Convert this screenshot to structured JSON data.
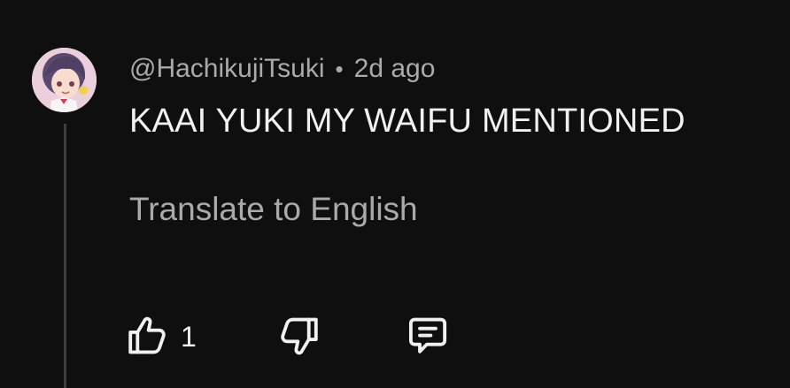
{
  "comment": {
    "author": "@HachikujiTsuki",
    "separator": "•",
    "timestamp": "2d ago",
    "text": "KAAI YUKI MY WAIFU MENTIONED",
    "translate_label": "Translate to English",
    "like_count": "1",
    "icons": {
      "avatar": "avatar",
      "like": "thumbs-up-icon",
      "dislike": "thumbs-down-icon",
      "reply": "comment-reply-icon"
    }
  },
  "colors": {
    "background": "#0f0f0f",
    "primary_text": "#f1f1f1",
    "secondary_text": "#aaaaaa",
    "thread_line": "#3f3f3f"
  }
}
